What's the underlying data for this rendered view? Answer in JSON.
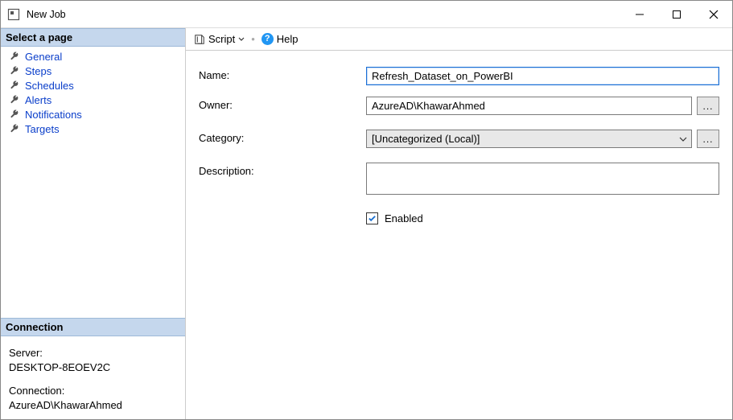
{
  "window": {
    "title": "New Job"
  },
  "toolbar": {
    "script_label": "Script",
    "help_label": "Help"
  },
  "sidebar": {
    "select_page_header": "Select a page",
    "pages": [
      {
        "label": "General"
      },
      {
        "label": "Steps"
      },
      {
        "label": "Schedules"
      },
      {
        "label": "Alerts"
      },
      {
        "label": "Notifications"
      },
      {
        "label": "Targets"
      }
    ],
    "connection_header": "Connection",
    "server_label": "Server:",
    "server_value": "DESKTOP-8EOEV2C",
    "connection_label": "Connection:",
    "connection_value": "AzureAD\\KhawarAhmed"
  },
  "form": {
    "name_label": "Name:",
    "name_value": "Refresh_Dataset_on_PowerBI",
    "owner_label": "Owner:",
    "owner_value": "AzureAD\\KhawarAhmed",
    "owner_browse": "...",
    "category_label": "Category:",
    "category_value": "[Uncategorized (Local)]",
    "category_browse": "...",
    "description_label": "Description:",
    "description_value": "",
    "enabled_label": "Enabled",
    "enabled_checked": true
  }
}
